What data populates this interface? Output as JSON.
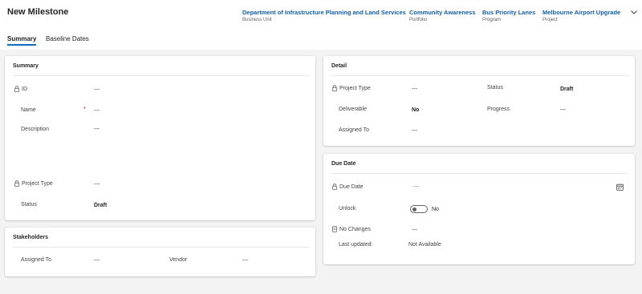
{
  "header": {
    "title": "New Milestone",
    "items": [
      {
        "value": "Department of Infrastructure Planning and Land Services",
        "type": "Business Unit"
      },
      {
        "value": "Community Awareness",
        "type": "Portfolio"
      },
      {
        "value": "Bus Priority Lanes",
        "type": "Program"
      },
      {
        "value": "Melbourne Airport Upgrade",
        "type": "Project"
      }
    ]
  },
  "tabs": [
    {
      "label": "Summary",
      "active": true
    },
    {
      "label": "Baseline Dates",
      "active": false
    }
  ],
  "summary": {
    "title": "Summary",
    "id_label": "ID",
    "id_value": "---",
    "name_label": "Name",
    "name_required": "*",
    "name_value": "---",
    "description_label": "Description",
    "description_value": "---",
    "project_type_label": "Project Type",
    "project_type_value": "---",
    "status_label": "Status",
    "status_value": "Draft"
  },
  "stakeholders": {
    "title": "Stakeholders",
    "assigned_to_label": "Assigned To",
    "assigned_to_value": "---",
    "vendor_label": "Vendor",
    "vendor_value": "---"
  },
  "detail": {
    "title": "Detail",
    "project_type_label": "Project Type",
    "project_type_value": "---",
    "status_label": "Status",
    "status_value": "Draft",
    "deliverable_label": "Deliverable",
    "deliverable_value": "No",
    "progress_label": "Progress",
    "progress_value": "---",
    "assigned_to_label": "Assigned To",
    "assigned_to_value": "---"
  },
  "due_date": {
    "title": "Due Date",
    "due_date_label": "Due Date",
    "due_date_value": "---",
    "unlock_label": "Unlock",
    "unlock_value": "No",
    "no_changes_label": "No Changes",
    "no_changes_value": "---",
    "last_updated_label": "Last updated:",
    "last_updated_value": "Not Available"
  },
  "colors": {
    "accent": "#0f6cbd",
    "link": "#115ea3",
    "canvas": "#f3f3f3"
  }
}
